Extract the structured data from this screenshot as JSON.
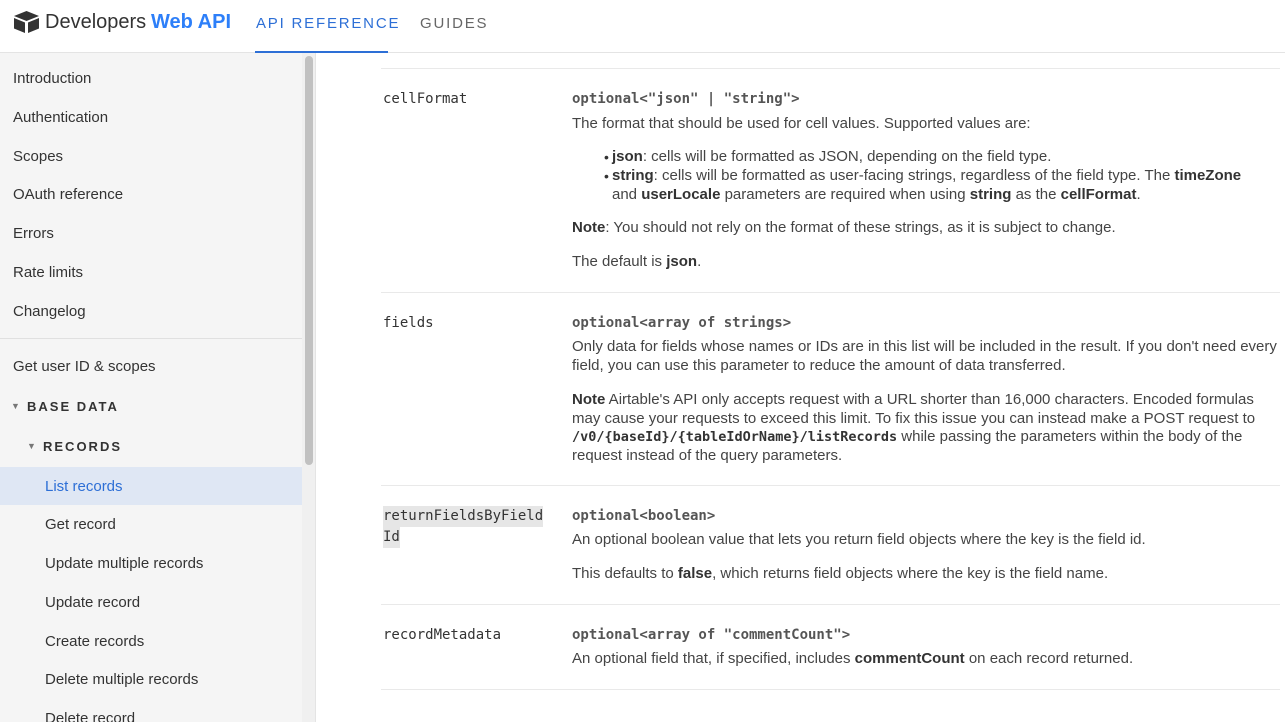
{
  "header": {
    "logo_text": "Developers",
    "logo_highlight": "Web API",
    "tabs": [
      "API REFERENCE",
      "GUIDES"
    ]
  },
  "sidebar": {
    "items_top": [
      "Introduction",
      "Authentication",
      "Scopes",
      "OAuth reference",
      "Errors",
      "Rate limits",
      "Changelog"
    ],
    "get_user": "Get user ID & scopes",
    "section_base": "BASE DATA",
    "section_records": "RECORDS",
    "record_items": [
      "List records",
      "Get record",
      "Update multiple records",
      "Update record",
      "Create records",
      "Delete multiple records",
      "Delete record"
    ]
  },
  "params": {
    "cellFormat": {
      "name": "cellFormat",
      "type": "optional<\"json\" | \"string\">",
      "desc": "The format that should be used for cell values. Supported values are:",
      "b1_key": "json",
      "b1_text": ": cells will be formatted as JSON, depending on the field type.",
      "b2_key": "string",
      "b2_text1": ": cells will be formatted as user-facing strings, regardless of the field type. The ",
      "b2_tz": "timeZone",
      "b2_and": "and ",
      "b2_locale": "userLocale",
      "b2_text2": " parameters are required when using ",
      "b2_string": "string",
      "b2_text3": " as the ",
      "b2_cellformat": "cellFormat",
      "b2_end": ".",
      "note_label": "Note",
      "note_text": ": You should not rely on the format of these strings, as it is subject to change.",
      "default_prefix": "The default is ",
      "default_value": "json",
      "default_end": "."
    },
    "fields": {
      "name": "fields",
      "type": "optional<array of strings>",
      "desc": "Only data for fields whose names or IDs are in this list will be included in the result. If you don't need every field, you can use this parameter to reduce the amount of data transferred.",
      "note_label": "Note",
      "note_text": " Airtable's API only accepts request with a URL shorter than 16,000 characters. Encoded formulas may cause your requests to exceed this limit. To fix this issue you can instead make a POST request to ",
      "note_code": "/v0/{baseId}/{tableIdOrName}/listRecords",
      "note_text2": " while passing the parameters within the body of the request instead of the query parameters."
    },
    "returnFieldsByFieldId": {
      "name_line1": "returnFieldsByField",
      "name_line2": "Id",
      "type": "optional<boolean>",
      "desc": "An optional boolean value that lets you return field objects where the key is the field id.",
      "default_prefix": "This defaults to ",
      "default_value": "false",
      "default_suffix": ", which returns field objects where the key is the field name."
    },
    "recordMetadata": {
      "name": "recordMetadata",
      "type": "optional<array of \"commentCount\">",
      "desc_prefix": "An optional field that, if specified, includes ",
      "desc_key": "commentCount",
      "desc_suffix": " on each record returned."
    }
  }
}
